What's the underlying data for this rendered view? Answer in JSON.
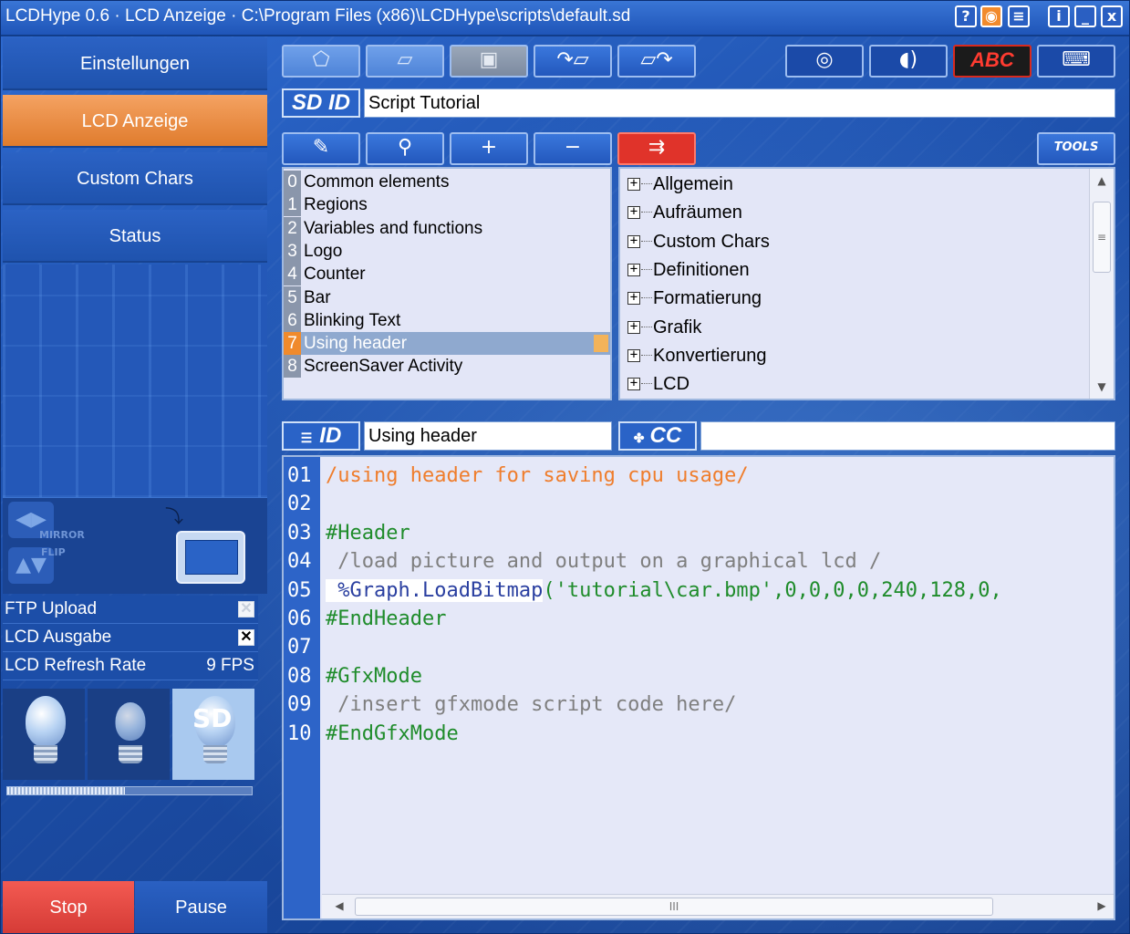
{
  "window": {
    "title": "LCDHype 0.6 · LCD Anzeige · C:\\Program Files (x86)\\LCDHype\\scripts\\default.sd",
    "buttons": [
      "?",
      "◉",
      "≡",
      "i",
      "_",
      "x"
    ]
  },
  "nav": {
    "items": [
      {
        "label": "Einstellungen",
        "active": false
      },
      {
        "label": "LCD Anzeige",
        "active": true
      },
      {
        "label": "Custom Chars",
        "active": false
      },
      {
        "label": "Status",
        "active": false
      }
    ]
  },
  "mirror_panel": {
    "mirror_label": "MIRROR",
    "flip_label": "FLIP"
  },
  "options": {
    "ftp_upload": {
      "label": "FTP Upload",
      "checked": false
    },
    "lcd_output": {
      "label": "LCD Ausgabe",
      "checked": true
    },
    "refresh_rate": {
      "label": "LCD Refresh Rate",
      "value": "9 FPS"
    }
  },
  "bulbs": {
    "sd_label": "SD",
    "progress_fraction": 0.48
  },
  "controls": {
    "stop_label": "Stop",
    "pause_label": "Pause"
  },
  "toolbar": {
    "abc_label": "ABC",
    "tools_label": "TOOLS",
    "sd_id_tag": "SD ID",
    "script_name": "Script Tutorial"
  },
  "actions": {
    "add_label": "+",
    "remove_label": "−"
  },
  "script_list": {
    "items": [
      {
        "num": "0",
        "label": "Common elements"
      },
      {
        "num": "1",
        "label": "Regions"
      },
      {
        "num": "2",
        "label": "Variables and functions"
      },
      {
        "num": "3",
        "label": "Logo"
      },
      {
        "num": "4",
        "label": "Counter"
      },
      {
        "num": "5",
        "label": "Bar"
      },
      {
        "num": "6",
        "label": "Blinking Text"
      },
      {
        "num": "7",
        "label": "Using header"
      },
      {
        "num": "8",
        "label": "ScreenSaver Activity"
      }
    ],
    "selected_index": 7
  },
  "function_tree": {
    "items": [
      "Allgemein",
      "Aufräumen",
      "Custom Chars",
      "Definitionen",
      "Formatierung",
      "Grafik",
      "Konvertierung",
      "LCD"
    ]
  },
  "section": {
    "id_tag": "ID",
    "id_value": "Using header",
    "cc_tag": "CC",
    "cc_value": ""
  },
  "code": {
    "lines": [
      {
        "n": "01",
        "text": "/using header for saving cpu usage/",
        "kind": "comment"
      },
      {
        "n": "02",
        "text": "",
        "kind": "plain"
      },
      {
        "n": "03",
        "text": "#Header",
        "kind": "directive"
      },
      {
        "n": "04",
        "text": " /load picture and output on a graphical lcd /",
        "kind": "grey"
      },
      {
        "n": "05",
        "text": "",
        "kind": "call",
        "fn": " %Graph.LoadBitmap",
        "args": "('tutorial\\car.bmp',0,0,0,0,240,128,0,"
      },
      {
        "n": "06",
        "text": "#EndHeader",
        "kind": "directive"
      },
      {
        "n": "07",
        "text": "",
        "kind": "plain"
      },
      {
        "n": "08",
        "text": "#GfxMode",
        "kind": "directive"
      },
      {
        "n": "09",
        "text": " /insert gfxmode script code here/",
        "kind": "grey"
      },
      {
        "n": "10",
        "text": "#EndGfxMode",
        "kind": "directive"
      }
    ]
  },
  "scroll": {
    "thumb_glyph": "III",
    "vthumb_glyph": "≡"
  }
}
